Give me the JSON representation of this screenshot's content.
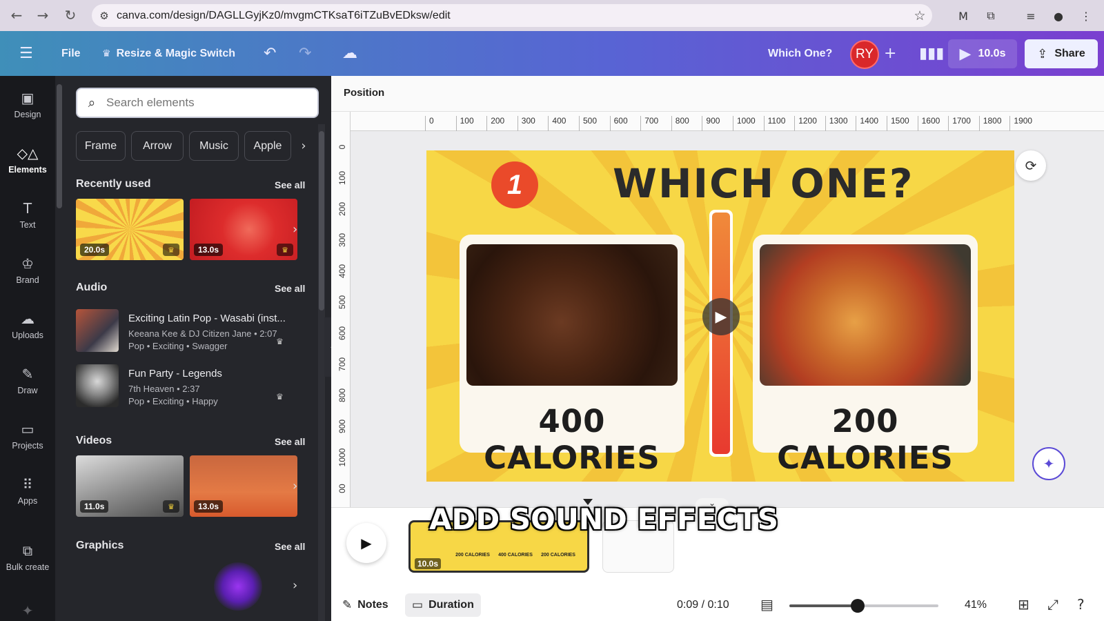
{
  "browser": {
    "url": "canva.com/design/DAGLLGyjKz0/mvgmCTKsaT6iTZuBvEDksw/edit"
  },
  "toolbar": {
    "file_label": "File",
    "resize_label": "Resize & Magic Switch",
    "design_title": "Which One?",
    "avatar_initials": "RY",
    "play_duration": "10.0s",
    "share_label": "Share"
  },
  "rail": {
    "items": [
      {
        "label": "Design",
        "icon": "design-icon"
      },
      {
        "label": "Elements",
        "icon": "elements-icon"
      },
      {
        "label": "Text",
        "icon": "text-icon"
      },
      {
        "label": "Brand",
        "icon": "brand-icon"
      },
      {
        "label": "Uploads",
        "icon": "uploads-icon"
      },
      {
        "label": "Draw",
        "icon": "draw-icon"
      },
      {
        "label": "Projects",
        "icon": "projects-icon"
      },
      {
        "label": "Apps",
        "icon": "apps-icon"
      },
      {
        "label": "Bulk create",
        "icon": "bulk-create-icon"
      }
    ],
    "active": "Elements"
  },
  "panel": {
    "search_placeholder": "Search elements",
    "chips": [
      "Frame",
      "Arrow",
      "Music",
      "Apple"
    ],
    "see_all": "See all",
    "recently_used": {
      "title": "Recently used",
      "items": [
        {
          "duration": "20.0s"
        },
        {
          "duration": "13.0s"
        }
      ]
    },
    "audio": {
      "title": "Audio",
      "items": [
        {
          "title": "Exciting Latin Pop - Wasabi (inst...",
          "artist": "Keeana Kee & DJ Citizen Jane • 2:07",
          "tags": "Pop • Exciting • Swagger"
        },
        {
          "title": "Fun Party - Legends",
          "artist": "7th Heaven • 2:37",
          "tags": "Pop • Exciting • Happy"
        }
      ]
    },
    "videos": {
      "title": "Videos",
      "items": [
        {
          "duration": "11.0s"
        },
        {
          "duration": "13.0s"
        }
      ]
    },
    "graphics": {
      "title": "Graphics"
    }
  },
  "editor": {
    "position_label": "Position",
    "ruler_h": [
      "0",
      "100",
      "200",
      "300",
      "400",
      "500",
      "600",
      "700",
      "800",
      "900",
      "1000",
      "1100",
      "1200",
      "1300",
      "1400",
      "1500",
      "1600",
      "1700",
      "1800",
      "1900"
    ],
    "ruler_v": [
      "0",
      "100",
      "200",
      "300",
      "400",
      "500",
      "600",
      "700",
      "800",
      "900",
      "1000",
      "00"
    ],
    "canvas": {
      "badge": "1",
      "title": "WHICH ONE?",
      "left_label": "400 CALORIES",
      "right_label": "200 CALORIES"
    }
  },
  "timeline": {
    "overlay_text": "ADD SOUND EFFECTS",
    "clip_duration": "10.0s",
    "clip_minis": [
      "200 CALORIES",
      "400 CALORIES",
      "200 CALORIES"
    ]
  },
  "footer": {
    "notes_label": "Notes",
    "duration_label": "Duration",
    "time": "0:09 / 0:10",
    "zoom": "41%",
    "zoom_level": 0.41
  },
  "colors": {
    "toolbar_gradient_start": "#3f8fb9",
    "toolbar_gradient_end": "#7a3fd0",
    "canvas_bg": "#f7d746",
    "badge_red": "#ea4a2a",
    "avatar_red": "#d9282b"
  }
}
